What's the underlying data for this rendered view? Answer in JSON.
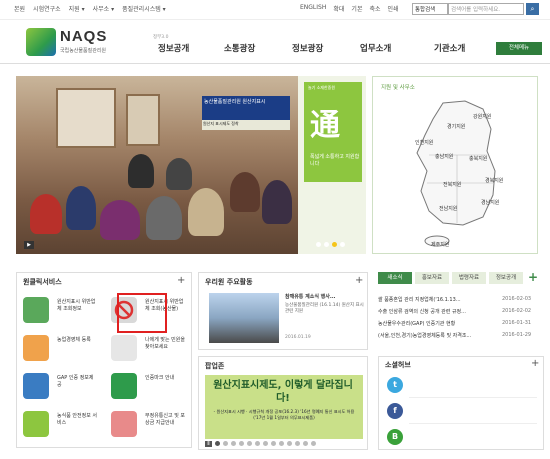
{
  "topbar": {
    "left_links": [
      "본원",
      "시험연구소",
      "지원 ▾",
      "사무소 ▾",
      "품질관리시스템 ▾"
    ],
    "right_links": [
      "ENGLISH",
      "확대",
      "기본",
      "축소",
      "인쇄"
    ],
    "search_select": "통합검색",
    "search_placeholder": "검색어를 입력하세요.",
    "search_icon": "search-icon"
  },
  "header": {
    "logo_text": "NAQS",
    "logo_sub": "국립농산물품질관리원",
    "nav_small": "정부3.0",
    "nav": [
      "정보공개",
      "소통광장",
      "정보광장",
      "업무소개",
      "기관소개"
    ],
    "all_menu": "전체메뉴"
  },
  "hero": {
    "banner_line1": "농산물품질관리원 원산지표시",
    "banner_line2": "원산지 표시제도 정착",
    "panel_tag": "놀기 소재한중원",
    "panel_char": "通",
    "panel_text": "폭넓게 소통하고 지원합니다",
    "play": "▶"
  },
  "map": {
    "title": "지원 및 사무소",
    "regions": [
      "강원지원",
      "경기지원",
      "충남지원",
      "충북지원",
      "전북지원",
      "경북지원",
      "전남지원",
      "경남지원",
      "제주지원",
      "인천지원"
    ]
  },
  "civil": {
    "title": "원클릭서비스",
    "more": "+",
    "services": [
      {
        "label": "원산지표시 위반업체 조회정보",
        "icon": "doc-icon",
        "color": "#5aa85b"
      },
      {
        "label": "원산지표시 위반업체 조회(농산물)",
        "icon": "no-sign-icon",
        "color": "#d9d9d9"
      },
      {
        "label": "농업경영체 등록",
        "icon": "pencil-icon",
        "color": "#f0a24b"
      },
      {
        "label": "나에게 맞는 민원을 찾아보세요",
        "icon": "pen-icon",
        "color": "#e6e6e6"
      },
      {
        "label": "GAP 인증 정보제공",
        "icon": "gap-icon",
        "color": "#3a7cc2"
      },
      {
        "label": "인증마크 안내",
        "icon": "mark-icon",
        "color": "#2e9b4b"
      },
      {
        "label": "농식품 안전정보 서비스",
        "icon": "safeq-icon",
        "color": "#8dc63f"
      },
      {
        "label": "부정유통신고 및 포상금 지급안내",
        "icon": "report-icon",
        "color": "#e88a8a"
      }
    ]
  },
  "major": {
    "title": "우리원 주요활동",
    "more": "+",
    "headline": "참깨유통 계소식 행사...",
    "body": "농산물품질관리원 (16.1.14) 원산지 표시 관련 지원",
    "date": "2016.01.19"
  },
  "popup": {
    "title": "팝업존",
    "headline": "원산지표시제도, 이렇게 달라집니다!",
    "small": "- 원산지표시 시행 · 시행규칙 개정 공포(16.2.3) '16년 명예지 통신 표시도 허용 ('17년 1월 1일부터 의무표시제품)",
    "pause": "Ⅱ"
  },
  "news": {
    "tabs": [
      "새소식",
      "홍보자료",
      "법령자료",
      "정보공개"
    ],
    "more": "+",
    "items": [
      {
        "title": "쌀 품종혼입 관리 지정업체('16.1.13...",
        "date": "2016-02-03"
      },
      {
        "title": "수출 인삼류 검역의 신청 공개 관련 규정...",
        "date": "2016-02-02"
      },
      {
        "title": "농산물우수관리(GAP) 인증기관 현황",
        "date": "2016-01-31"
      },
      {
        "title": "(서울,인천,경기)농업경영체등록 및 자격조...",
        "date": "2016-01-29"
      }
    ]
  },
  "social": {
    "title": "소셜허브",
    "more": "+",
    "items": [
      {
        "icon": "twitter-icon",
        "glyph": "t",
        "color": "#3ba8df"
      },
      {
        "icon": "facebook-icon",
        "glyph": "f",
        "color": "#3b5998"
      },
      {
        "icon": "blog-icon",
        "glyph": "B",
        "color": "#3aa13a"
      }
    ]
  }
}
